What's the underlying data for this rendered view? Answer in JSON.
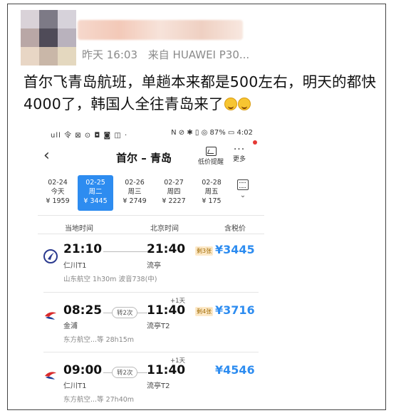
{
  "post": {
    "time": "昨天 16:03",
    "source": "来自 HUAWEI P30...",
    "text": "首尔飞青岛航班，单趟本来都是500左右，明天的都快4000了，韩国人全往青岛来了"
  },
  "colors": {
    "accent": "#2d8cf0",
    "seat_badge_bg": "#fde9c8"
  },
  "phone": {
    "status_bar": {
      "left": "ull 令 ⊠ ⊙ ◘ ◙ ◫ ·",
      "right": "N ⊘ ✱ ▯ ◎ 87% ▭ 4:02"
    },
    "nav": {
      "back_icon": "chevron-left-icon",
      "route": "首尔 – 青岛",
      "alert_label": "低价提醒",
      "more_label": "更多"
    },
    "dates": [
      {
        "date": "02-24",
        "dow": "今天",
        "price": "¥ 1959",
        "selected": false
      },
      {
        "date": "02-25",
        "dow": "周二",
        "price": "¥ 3445",
        "selected": true
      },
      {
        "date": "02-26",
        "dow": "周三",
        "price": "¥ 2749",
        "selected": false
      },
      {
        "date": "02-27",
        "dow": "周四",
        "price": "¥ 2227",
        "selected": false
      },
      {
        "date": "02-28",
        "dow": "周五",
        "price": "¥ 175",
        "selected": false
      }
    ],
    "columns": {
      "local": "当地时间",
      "beijing": "北京时间",
      "tax": "含税价"
    },
    "flights": [
      {
        "dep_time": "21:10",
        "dep_airport": "仁川T1",
        "arr_time": "21:40",
        "arr_airport": "流亭",
        "plus_day": "",
        "transfer": "",
        "seats": "剩3张",
        "price": "¥3445",
        "airline_info": "山东航空   1h30m   波音738(中)",
        "logo": "shandong-airlines-logo"
      },
      {
        "dep_time": "08:25",
        "dep_airport": "金浦",
        "arr_time": "11:40",
        "arr_airport": "流亭T2",
        "plus_day": "+1天",
        "transfer": "转2次",
        "seats": "剩4张",
        "price": "¥3716",
        "airline_info": "东方航空...等   28h15m",
        "logo": "china-eastern-logo"
      },
      {
        "dep_time": "09:00",
        "dep_airport": "仁川T1",
        "arr_time": "11:40",
        "arr_airport": "流亭T2",
        "plus_day": "+1天",
        "transfer": "转2次",
        "seats": "",
        "price": "¥4546",
        "airline_info": "东方航空...等   27h40m",
        "logo": "china-eastern-logo"
      }
    ]
  }
}
